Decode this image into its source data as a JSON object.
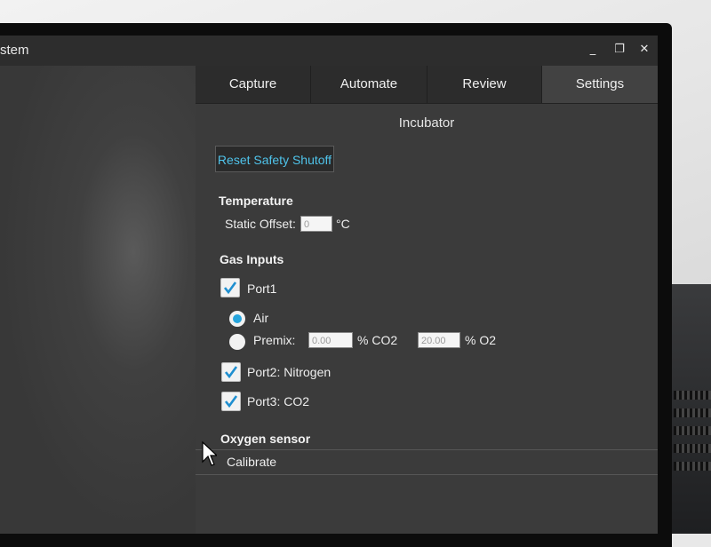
{
  "window": {
    "title_fragment": "stem",
    "controls": {
      "minimize": "_",
      "restore": "❐",
      "close": "✕"
    }
  },
  "tabs": [
    {
      "label": "Capture",
      "active": false
    },
    {
      "label": "Automate",
      "active": false
    },
    {
      "label": "Review",
      "active": false
    },
    {
      "label": "Settings",
      "active": true
    }
  ],
  "incubator": {
    "title": "Incubator",
    "reset_button": "Reset Safety Shutoff",
    "temperature": {
      "heading": "Temperature",
      "static_offset_label": "Static Offset:",
      "static_offset_value": "0",
      "unit": "°C"
    },
    "gas_inputs": {
      "heading": "Gas Inputs",
      "port1": {
        "label": "Port1",
        "checked": true
      },
      "air": {
        "label": "Air",
        "selected": true
      },
      "premix": {
        "label": "Premix:",
        "selected": false,
        "co2_value": "0.00",
        "co2_unit": "% CO2",
        "o2_value": "20.00",
        "o2_unit": "% O2"
      },
      "port2": {
        "label": "Port2: Nitrogen",
        "checked": true
      },
      "port3": {
        "label": "Port3: CO2",
        "checked": true
      }
    },
    "oxygen_sensor": {
      "heading": "Oxygen sensor",
      "calibrate_label": "Calibrate"
    }
  },
  "colors": {
    "accent": "#26a5dd",
    "button_text": "#4fc3ea",
    "panel_bg": "#3b3b3b",
    "tab_bg": "#2c2c2c"
  }
}
